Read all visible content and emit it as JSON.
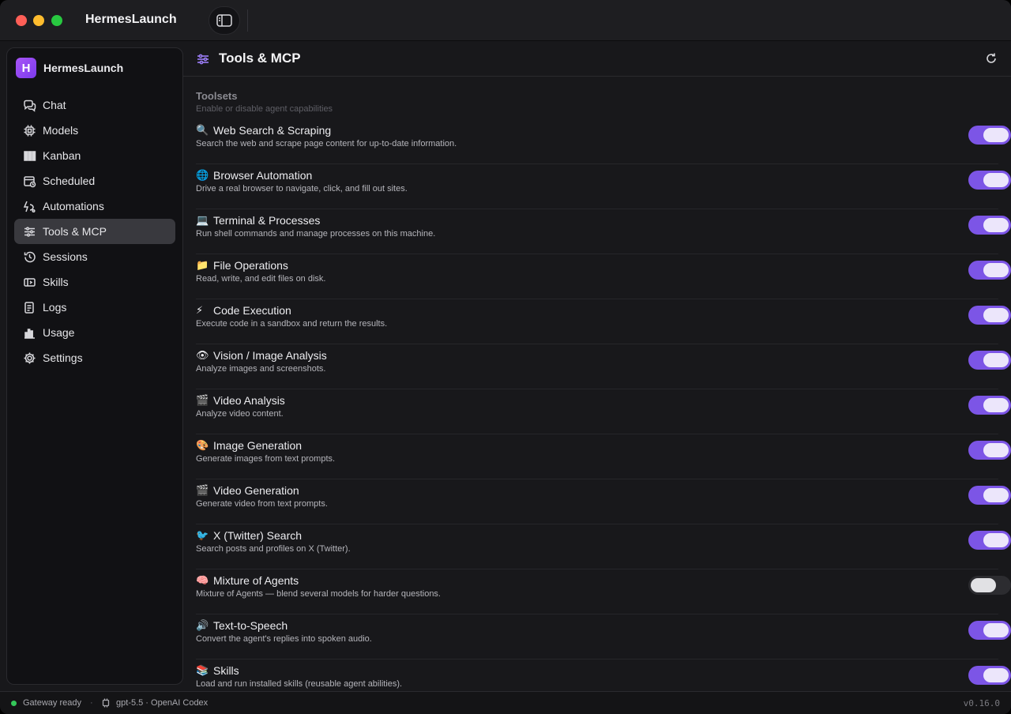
{
  "app": {
    "title": "HermesLaunch",
    "brand_letter": "H",
    "brand_name": "HermesLaunch"
  },
  "sidebar": {
    "items": [
      {
        "label": "Chat",
        "icon": "chat-bubbles-icon",
        "active": false
      },
      {
        "label": "Models",
        "icon": "chip-icon",
        "active": false
      },
      {
        "label": "Kanban",
        "icon": "kanban-icon",
        "active": false
      },
      {
        "label": "Scheduled",
        "icon": "calendar-clock-icon",
        "active": false
      },
      {
        "label": "Automations",
        "icon": "automation-icon",
        "active": false
      },
      {
        "label": "Tools & MCP",
        "icon": "sliders-icon",
        "active": true
      },
      {
        "label": "Sessions",
        "icon": "history-icon",
        "active": false
      },
      {
        "label": "Skills",
        "icon": "skills-icon",
        "active": false
      },
      {
        "label": "Logs",
        "icon": "logs-icon",
        "active": false
      },
      {
        "label": "Usage",
        "icon": "bar-chart-icon",
        "active": false
      },
      {
        "label": "Settings",
        "icon": "gear-icon",
        "active": false
      }
    ]
  },
  "main": {
    "title": "Tools & MCP",
    "section_title": "Toolsets",
    "section_subtitle": "Enable or disable agent capabilities",
    "toolsets": [
      {
        "emoji": "🔍",
        "name": "Web Search & Scraping",
        "description": "Search the web and scrape page content for up-to-date information.",
        "enabled": true
      },
      {
        "emoji": "🌐",
        "name": "Browser Automation",
        "description": "Drive a real browser to navigate, click, and fill out sites.",
        "enabled": true
      },
      {
        "emoji": "💻",
        "name": "Terminal & Processes",
        "description": "Run shell commands and manage processes on this machine.",
        "enabled": true
      },
      {
        "emoji": "📁",
        "name": "File Operations",
        "description": "Read, write, and edit files on disk.",
        "enabled": true
      },
      {
        "emoji": "⚡",
        "name": "Code Execution",
        "description": "Execute code in a sandbox and return the results.",
        "enabled": true
      },
      {
        "emoji": "👁",
        "name": "Vision / Image Analysis",
        "description": "Analyze images and screenshots.",
        "enabled": true
      },
      {
        "emoji": "🎬",
        "name": "Video Analysis",
        "description": "Analyze video content.",
        "enabled": true
      },
      {
        "emoji": "🎨",
        "name": "Image Generation",
        "description": "Generate images from text prompts.",
        "enabled": true
      },
      {
        "emoji": "🎬",
        "name": "Video Generation",
        "description": "Generate video from text prompts.",
        "enabled": true
      },
      {
        "emoji": "🐦",
        "name": "X (Twitter) Search",
        "description": "Search posts and profiles on X (Twitter).",
        "enabled": true
      },
      {
        "emoji": "🧠",
        "name": "Mixture of Agents",
        "description": "Mixture of Agents — blend several models for harder questions.",
        "enabled": false
      },
      {
        "emoji": "🔊",
        "name": "Text-to-Speech",
        "description": "Convert the agent's replies into spoken audio.",
        "enabled": true
      },
      {
        "emoji": "📚",
        "name": "Skills",
        "description": "Load and run installed skills (reusable agent abilities).",
        "enabled": true
      }
    ]
  },
  "status": {
    "gateway": "Gateway ready",
    "separator": "·",
    "model": "gpt-5.5 · OpenAI Codex",
    "version": "v0.16.0"
  },
  "colors": {
    "accent": "#7c55e6",
    "brand": "#a855f7",
    "status_ok": "#34c759"
  }
}
